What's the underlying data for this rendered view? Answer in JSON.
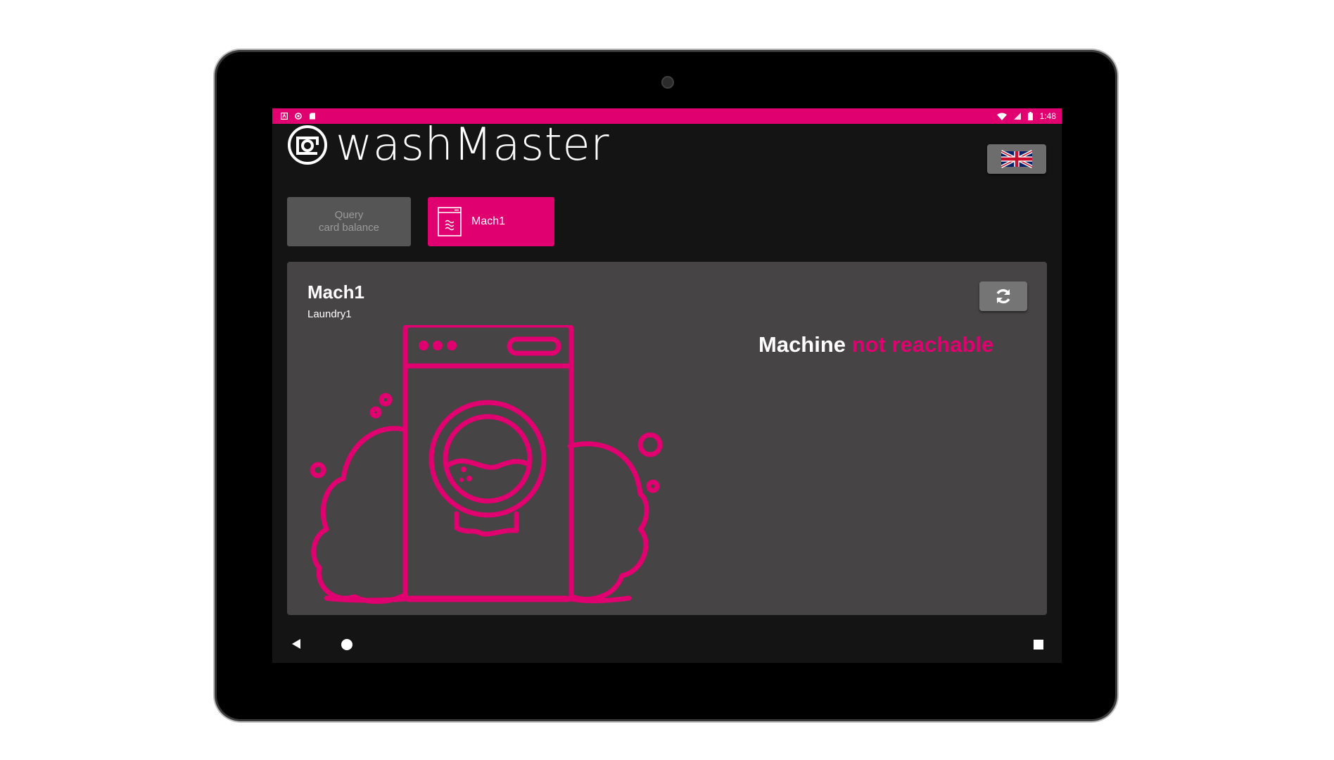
{
  "status_bar": {
    "time": "1:48",
    "left_icons": [
      "a-icon",
      "sync-circle-icon",
      "sd-card-icon"
    ],
    "right_icons": [
      "wifi-icon",
      "signal-icon",
      "battery-icon"
    ]
  },
  "app": {
    "brand_text": "washMaster",
    "language": "English (UK flag)"
  },
  "tiles": {
    "balance_line1": "Query",
    "balance_line2": "card balance",
    "machine_label": "Mach1"
  },
  "machine": {
    "name": "Mach1",
    "location": "Laundry1",
    "status_prefix": "Machine",
    "status_value": "not reachable"
  },
  "colors": {
    "accent": "#e0006f",
    "panel": "#464444",
    "background": "#141414"
  }
}
